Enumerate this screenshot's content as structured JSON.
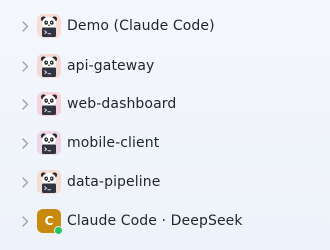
{
  "items": [
    {
      "label": "Demo (Claude Code)",
      "icon": "panda-terminal-icon"
    },
    {
      "label": "api-gateway",
      "icon": "panda-terminal-icon"
    },
    {
      "label": "web-dashboard",
      "icon": "panda-terminal-icon"
    },
    {
      "label": "mobile-client",
      "icon": "panda-terminal-icon"
    },
    {
      "label": "data-pipeline",
      "icon": "panda-terminal-icon"
    },
    {
      "label": "Claude Code · DeepSeek",
      "letter": "C",
      "icon": "letter-avatar-icon",
      "status": "online"
    }
  ],
  "colors": {
    "text": "#1f2430",
    "chevron": "#9aa1ad",
    "letter_avatar": "#c88a0c",
    "status_online": "#22c55e"
  }
}
